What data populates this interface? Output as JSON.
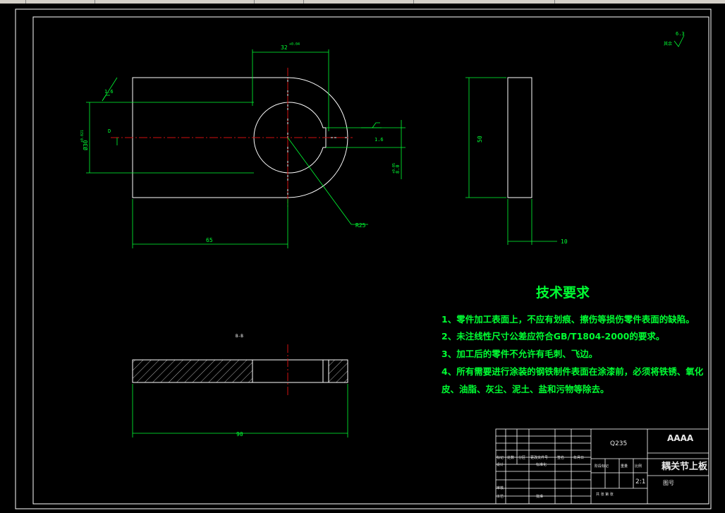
{
  "dimensions": {
    "width_32": "32",
    "width_32_tol": "+0.04",
    "height_30": "Ø30",
    "height_30_tol": "+0.021",
    "length_65": "65",
    "radius": "R25",
    "slot_tol": "+0.05",
    "slot_val": "8.0",
    "side_height": "50",
    "thickness": "10",
    "total_length": "90"
  },
  "roughness": {
    "general": "6.3",
    "general_prefix": "其余",
    "surface_left": "1.6",
    "surface_right": "1.6"
  },
  "section_labels": {
    "datum": "D",
    "section_mark": "B-B"
  },
  "tech": {
    "title": "技术要求",
    "items": [
      "1、零件加工表面上，不应有划痕、擦伤等损伤零件表面的缺陷。",
      "2、未注线性尺寸公差应符合GB/T1804-2000的要求。",
      "3、加工后的零件不允许有毛刺、飞边。",
      "4、所有需要进行涂装的钢铁制件表面在涂漆前，必须将铁锈、氧化",
      "皮、油脂、灰尘、泥土、盐和污物等除去。"
    ]
  },
  "title_block": {
    "material": "Q235",
    "company": "AAAA",
    "part_name": "耦关节上板",
    "scale": "2:1",
    "drawing_no": "图号",
    "headers": [
      "标记",
      "处数",
      "分区",
      "更改文件号",
      "签名",
      "年月日"
    ],
    "row_design": "设计",
    "row_std": "标准化",
    "row_review": "审核",
    "row_process": "工艺",
    "row_approve": "批准",
    "stage_mark": "阶段标记",
    "weight": "重量",
    "scale_label": "比例",
    "sheet_info": "共 张 第 张"
  }
}
